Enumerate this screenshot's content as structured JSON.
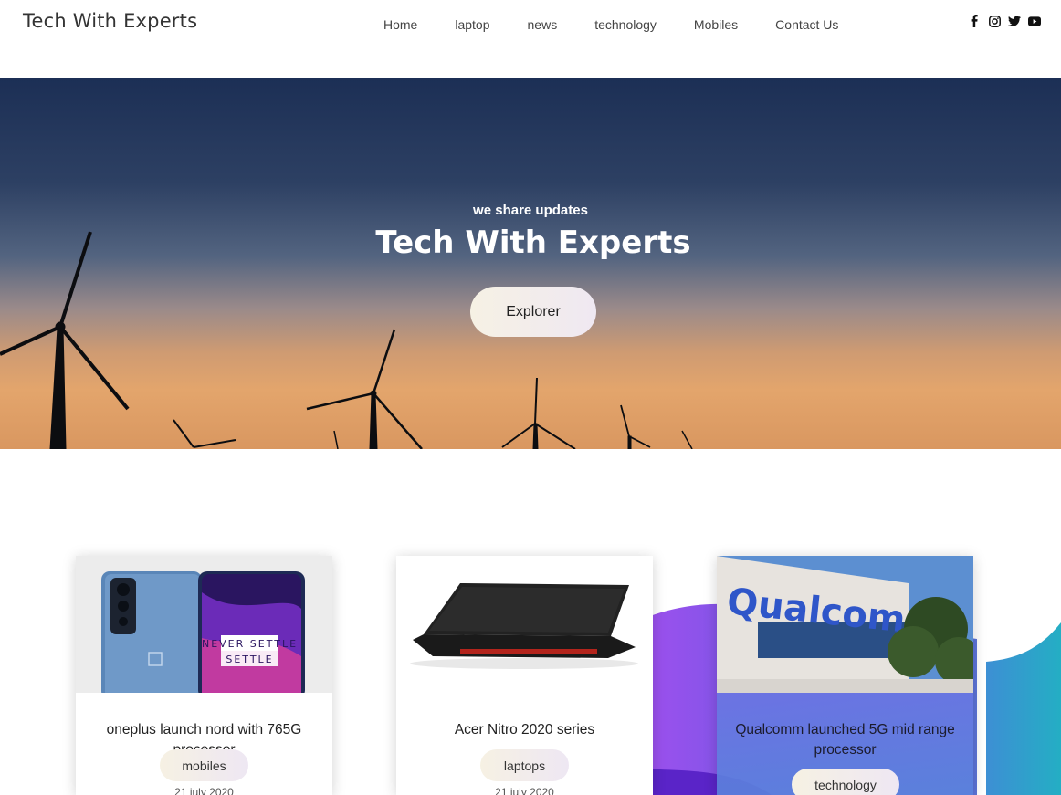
{
  "header": {
    "brand": "Tech With Experts",
    "nav": [
      "Home",
      "laptop",
      "news",
      "technology",
      "Mobiles",
      "Contact Us"
    ],
    "social": [
      {
        "icon": "facebook-icon"
      },
      {
        "icon": "instagram-icon"
      },
      {
        "icon": "twitter-icon"
      },
      {
        "icon": "youtube-icon"
      }
    ]
  },
  "hero": {
    "subtitle": "we share updates",
    "title": "Tech With Experts",
    "button": "Explorer"
  },
  "posts": [
    {
      "title": "oneplus launch nord with 765G processor",
      "tag": "mobiles",
      "date": "21 july 2020",
      "image_text": "NEVER SETTLE"
    },
    {
      "title": "Acer Nitro 2020 series",
      "tag": "laptops",
      "date": "21 july 2020"
    },
    {
      "title": "Qualcomm launched 5G mid range processor",
      "tag": "technology",
      "image_text": "Qualcomm"
    }
  ],
  "colors": {
    "accent_purple": "#8a4be8",
    "accent_teal": "#25a7c6"
  }
}
